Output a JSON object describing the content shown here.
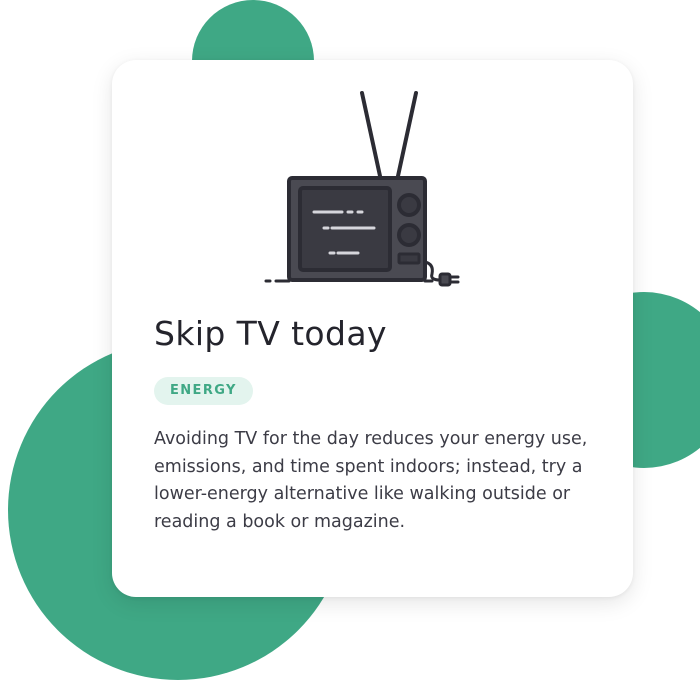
{
  "card": {
    "title": "Skip TV today",
    "category": "ENERGY",
    "description": "Avoiding TV for the day reduces your energy use, emissions, and time spent indoors; instead, try a lower-energy alternative like walking outside or reading a book or magazine."
  },
  "illustration": {
    "icon": "television-icon"
  },
  "colors": {
    "accent": "#3fa885",
    "badge_background": "#e3f4ee",
    "title_text": "#24242c",
    "body_text": "#3c3c46",
    "tv_body": "#4a4a52",
    "tv_screen": "#3a3a42",
    "tv_outline": "#2c2c34"
  }
}
